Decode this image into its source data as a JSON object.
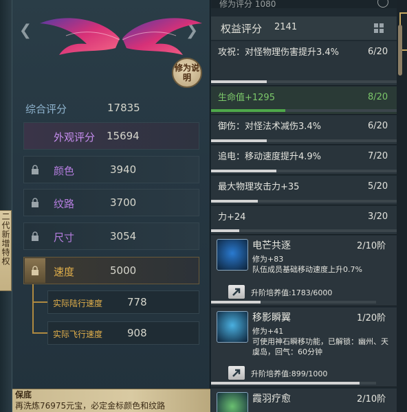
{
  "side_tab": {
    "label": "二代新增特权"
  },
  "appearance": {
    "modify_button": "修为说明",
    "total_score_label": "综合评分",
    "total_score_value": "17835",
    "rows": [
      {
        "label": "外观评分",
        "value": "15694"
      },
      {
        "label": "颜色",
        "value": "3940"
      },
      {
        "label": "纹路",
        "value": "3700"
      },
      {
        "label": "尺寸",
        "value": "3054"
      },
      {
        "label": "速度",
        "value": "5000"
      }
    ],
    "sub_rows": [
      {
        "label": "实际陆行速度",
        "value": "778"
      },
      {
        "label": "实际飞行速度",
        "value": "908"
      }
    ]
  },
  "notice": {
    "title": "保底",
    "text": "再洗炼76975元宝，必定金标颜色和纹路"
  },
  "rights": {
    "top_strip": "修为评分 1080",
    "title": "权益评分",
    "value": "2141",
    "attributes": [
      {
        "text": "攻祝：对怪物理伤害提升3.4%",
        "count": "6/20",
        "progress": 0.3,
        "green": false
      },
      {
        "text": "生命值+1295",
        "count": "8/20",
        "progress": 0.4,
        "green": true
      },
      {
        "text": "御伤：对怪法术减伤3.4%",
        "count": "6/20",
        "progress": 0.3,
        "green": false
      },
      {
        "text": "追电：移动速度提升4.9%",
        "count": "7/20",
        "progress": 0.35,
        "green": false
      },
      {
        "text": "最大物理攻击力+35",
        "count": "5/20",
        "progress": 0.25,
        "green": false
      },
      {
        "text": "力+24",
        "count": "3/20",
        "progress": 0.15,
        "green": false
      }
    ],
    "skills": [
      {
        "name": "电芒共逐",
        "level": "2/10阶",
        "desc": "修为+83\n队伍成员基础移动速度上升0.7%",
        "cultivate": "升阶培养值:1783/6000",
        "progress": 0.3
      },
      {
        "name": "移影瞬翼",
        "level": "1/20阶",
        "desc": "修为+41\n可使用神石瞬移功能，已解锁：幽州、天虞岛，回气：60分钟",
        "cultivate": "升阶培养值:899/1000",
        "progress": 0.9
      },
      {
        "name": "霞羽疗愈",
        "level": "2/10阶"
      }
    ]
  }
}
